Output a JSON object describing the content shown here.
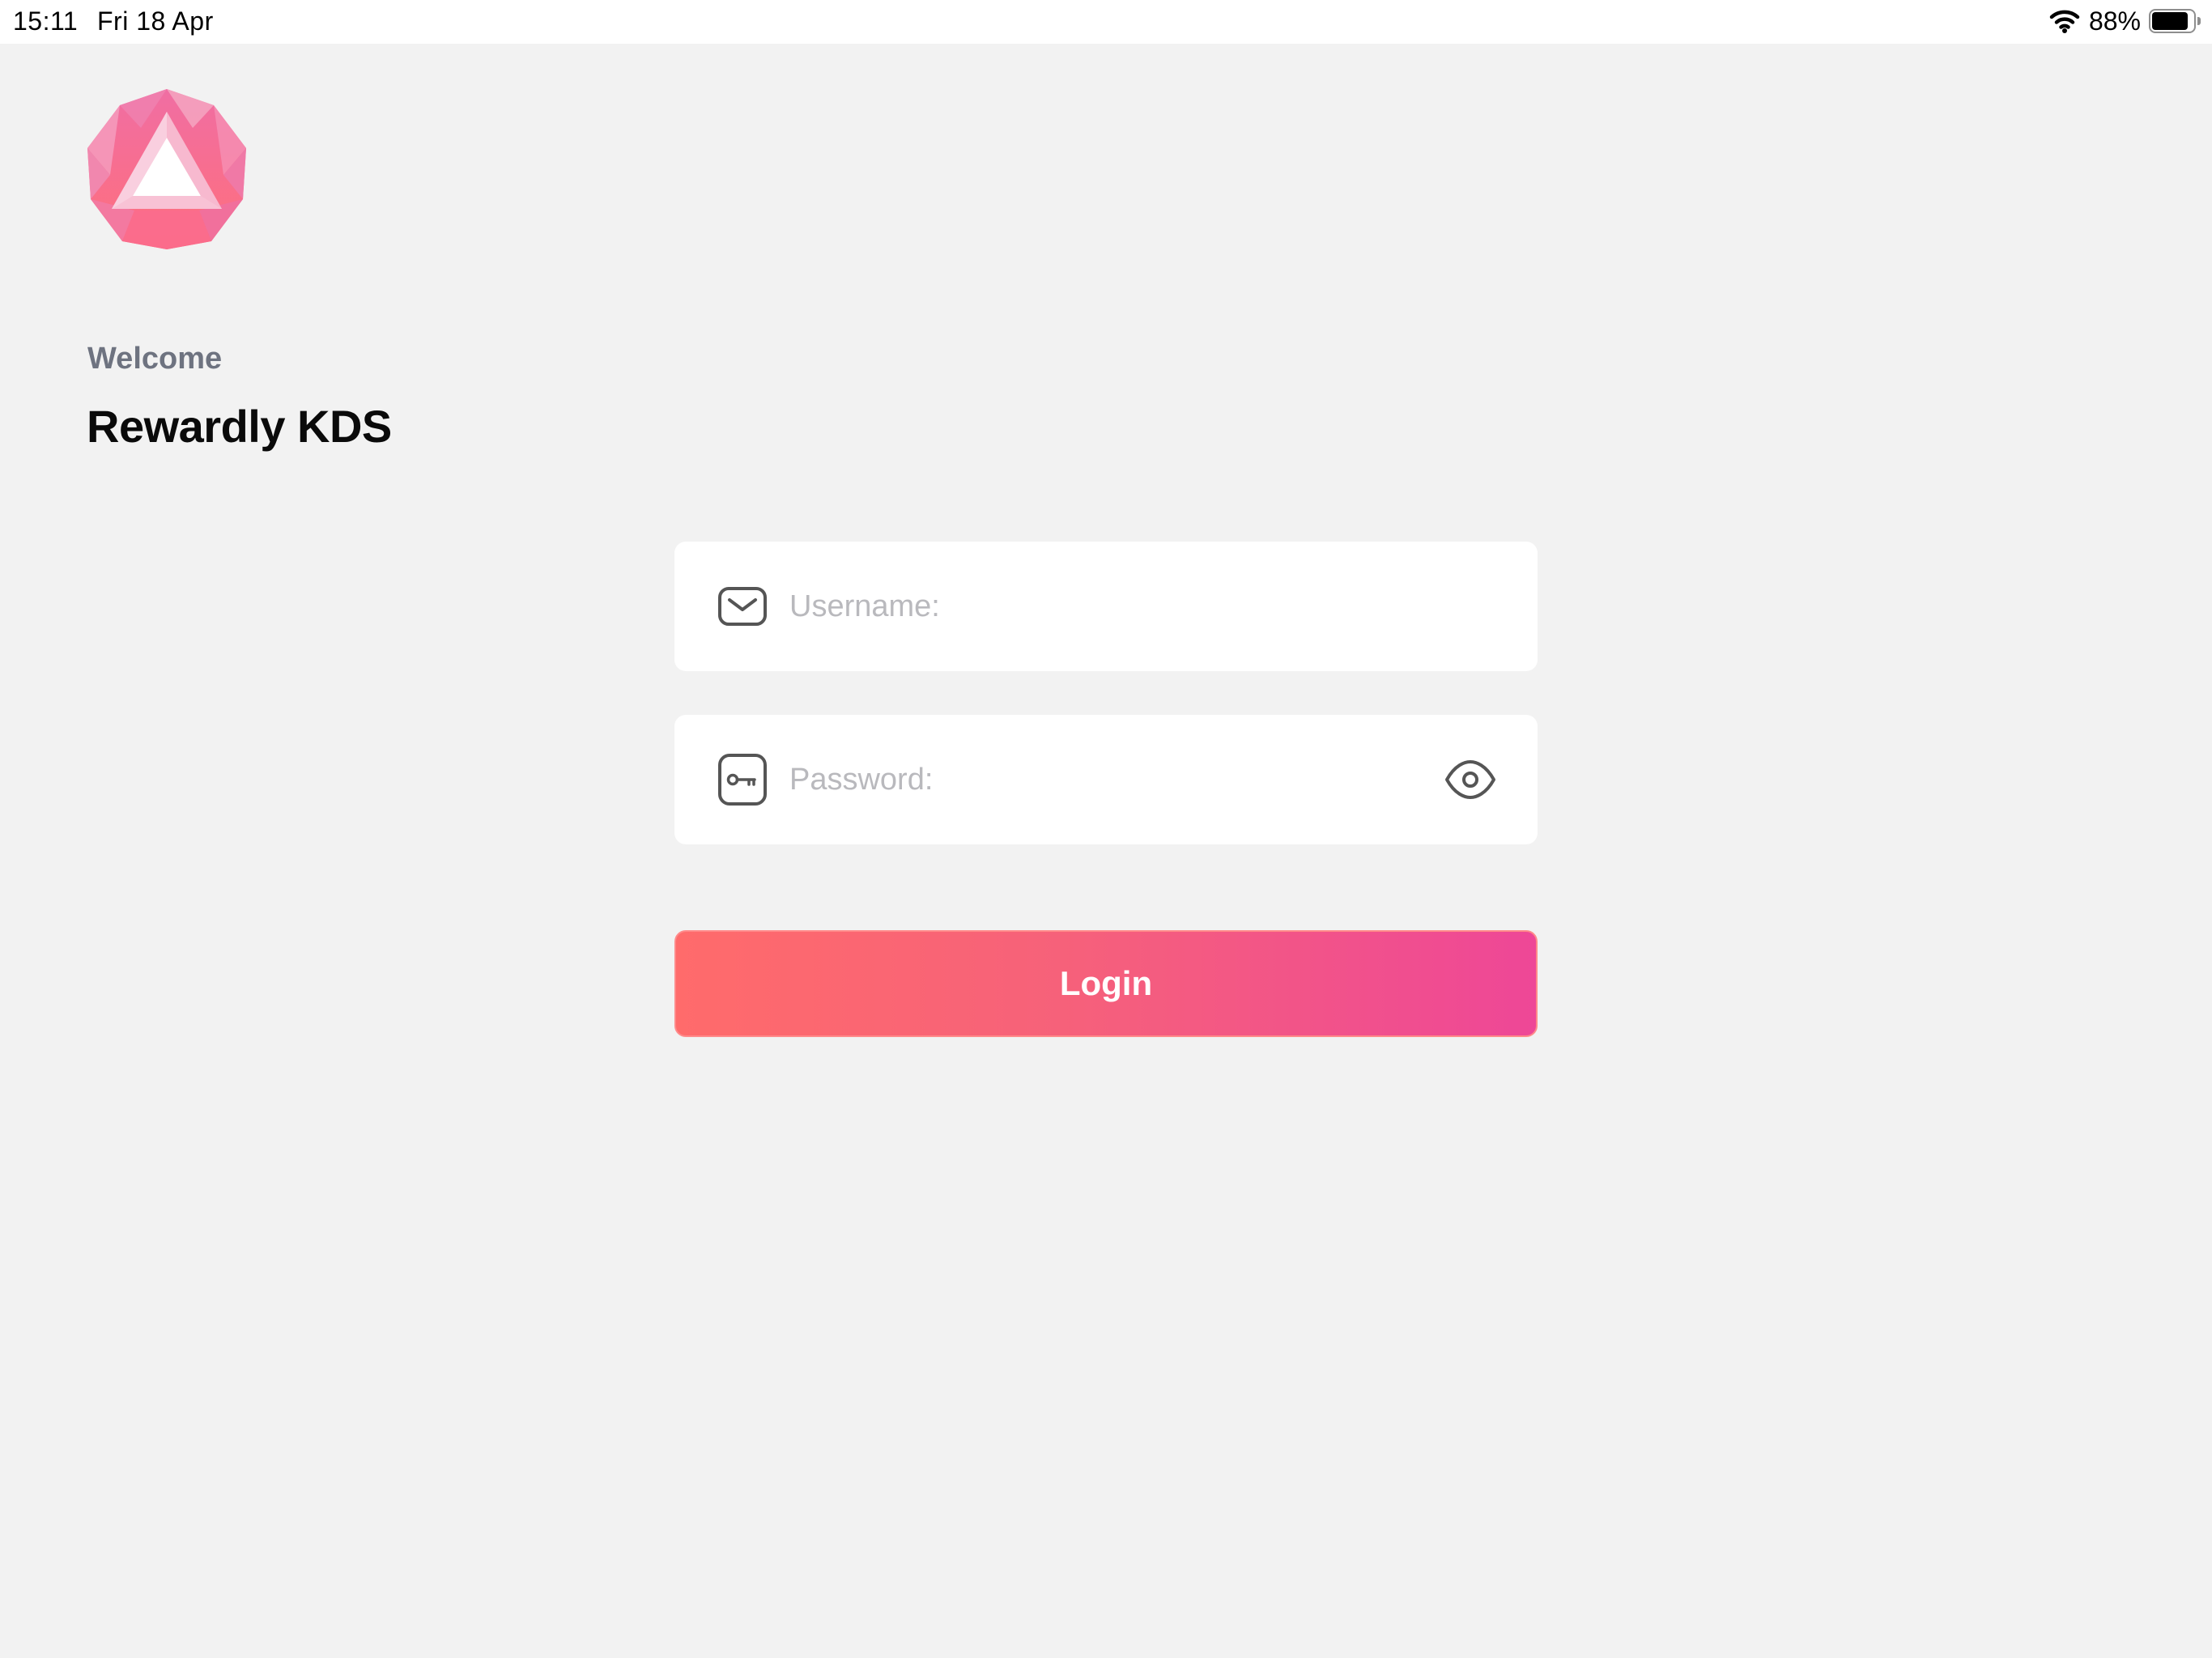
{
  "status_bar": {
    "time": "15:11",
    "date": "Fri 18 Apr",
    "battery_percent_label": "88%",
    "battery_level": 0.88,
    "wifi_icon": "wifi-icon",
    "battery_icon": "battery-icon"
  },
  "branding": {
    "logo_icon": "rewardly-logo",
    "welcome": "Welcome",
    "app_title": "Rewardly KDS"
  },
  "form": {
    "username": {
      "icon": "envelope-icon",
      "value": "",
      "placeholder": "Username:"
    },
    "password": {
      "icon": "key-icon",
      "value": "",
      "placeholder": "Password:",
      "toggle_icon": "eye-icon"
    },
    "login_label": "Login"
  },
  "colors": {
    "background": "#f2f2f2",
    "field_background": "#ffffff",
    "login_gradient_start": "#ff6b6b",
    "login_gradient_end": "#ee4797",
    "welcome_text": "#6e7380",
    "placeholder_text": "#b9b9bd"
  }
}
